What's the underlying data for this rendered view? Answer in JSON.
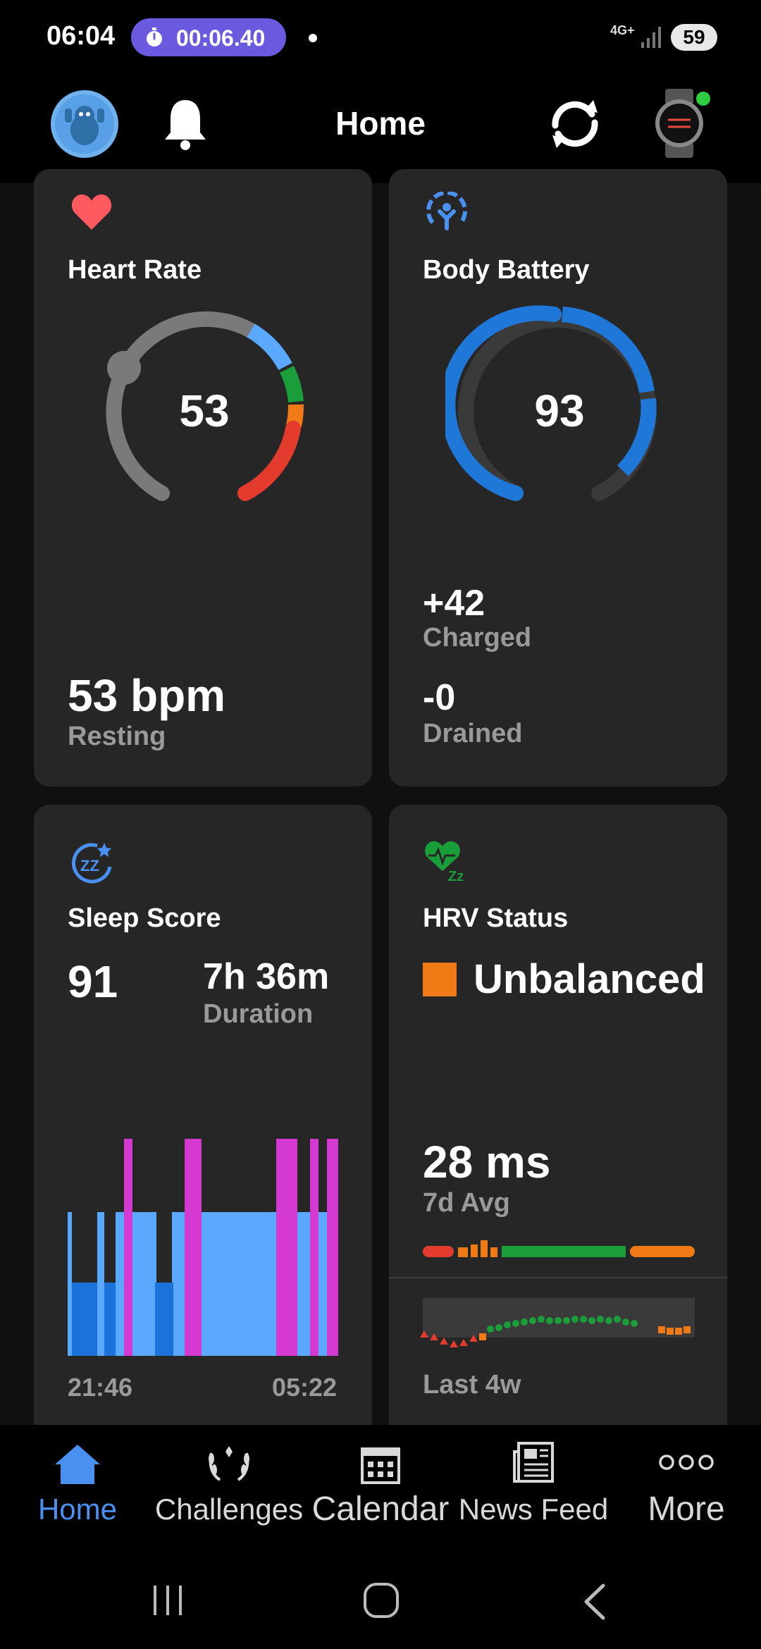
{
  "status_bar": {
    "time": "06:04",
    "timer": "00:06.40",
    "network": "4G+",
    "battery": "59"
  },
  "header": {
    "title": "Home"
  },
  "heart_rate": {
    "title": "Heart Rate",
    "gauge_value": "53",
    "resting_value": "53 bpm",
    "resting_label": "Resting"
  },
  "body_battery": {
    "title": "Body Battery",
    "gauge_value": "93",
    "charged_value": "+42",
    "charged_label": "Charged",
    "drained_value": "-0",
    "drained_label": "Drained"
  },
  "sleep": {
    "title": "Sleep Score",
    "score": "91",
    "duration_value": "7h 36m",
    "duration_label": "Duration",
    "start_time": "21:46",
    "end_time": "05:22"
  },
  "hrv": {
    "title": "HRV Status",
    "status": "Unbalanced",
    "status_color": "#f07a16",
    "avg_value": "28 ms",
    "avg_label": "7d Avg",
    "range_label": "Last 4w"
  },
  "bottom_nav": {
    "items": [
      {
        "label": "Home",
        "icon": "home-icon",
        "active": true
      },
      {
        "label": "Challenges",
        "icon": "laurel-icon",
        "active": false
      },
      {
        "label": "Calendar",
        "icon": "calendar-icon",
        "active": false
      },
      {
        "label": "News Feed",
        "icon": "newspaper-icon",
        "active": false
      },
      {
        "label": "More",
        "icon": "more-icon",
        "active": false
      }
    ]
  },
  "colors": {
    "accent": "#4a90f0",
    "timer_pill": "#6a5ae0",
    "heart": "#ff5a5f",
    "body_battery": "#1f78d8",
    "sleep_light": "#5aa8ff",
    "sleep_deep": "#1b72d8",
    "sleep_rem": "#d43ad0",
    "hrv_green": "#1a9e3a"
  }
}
